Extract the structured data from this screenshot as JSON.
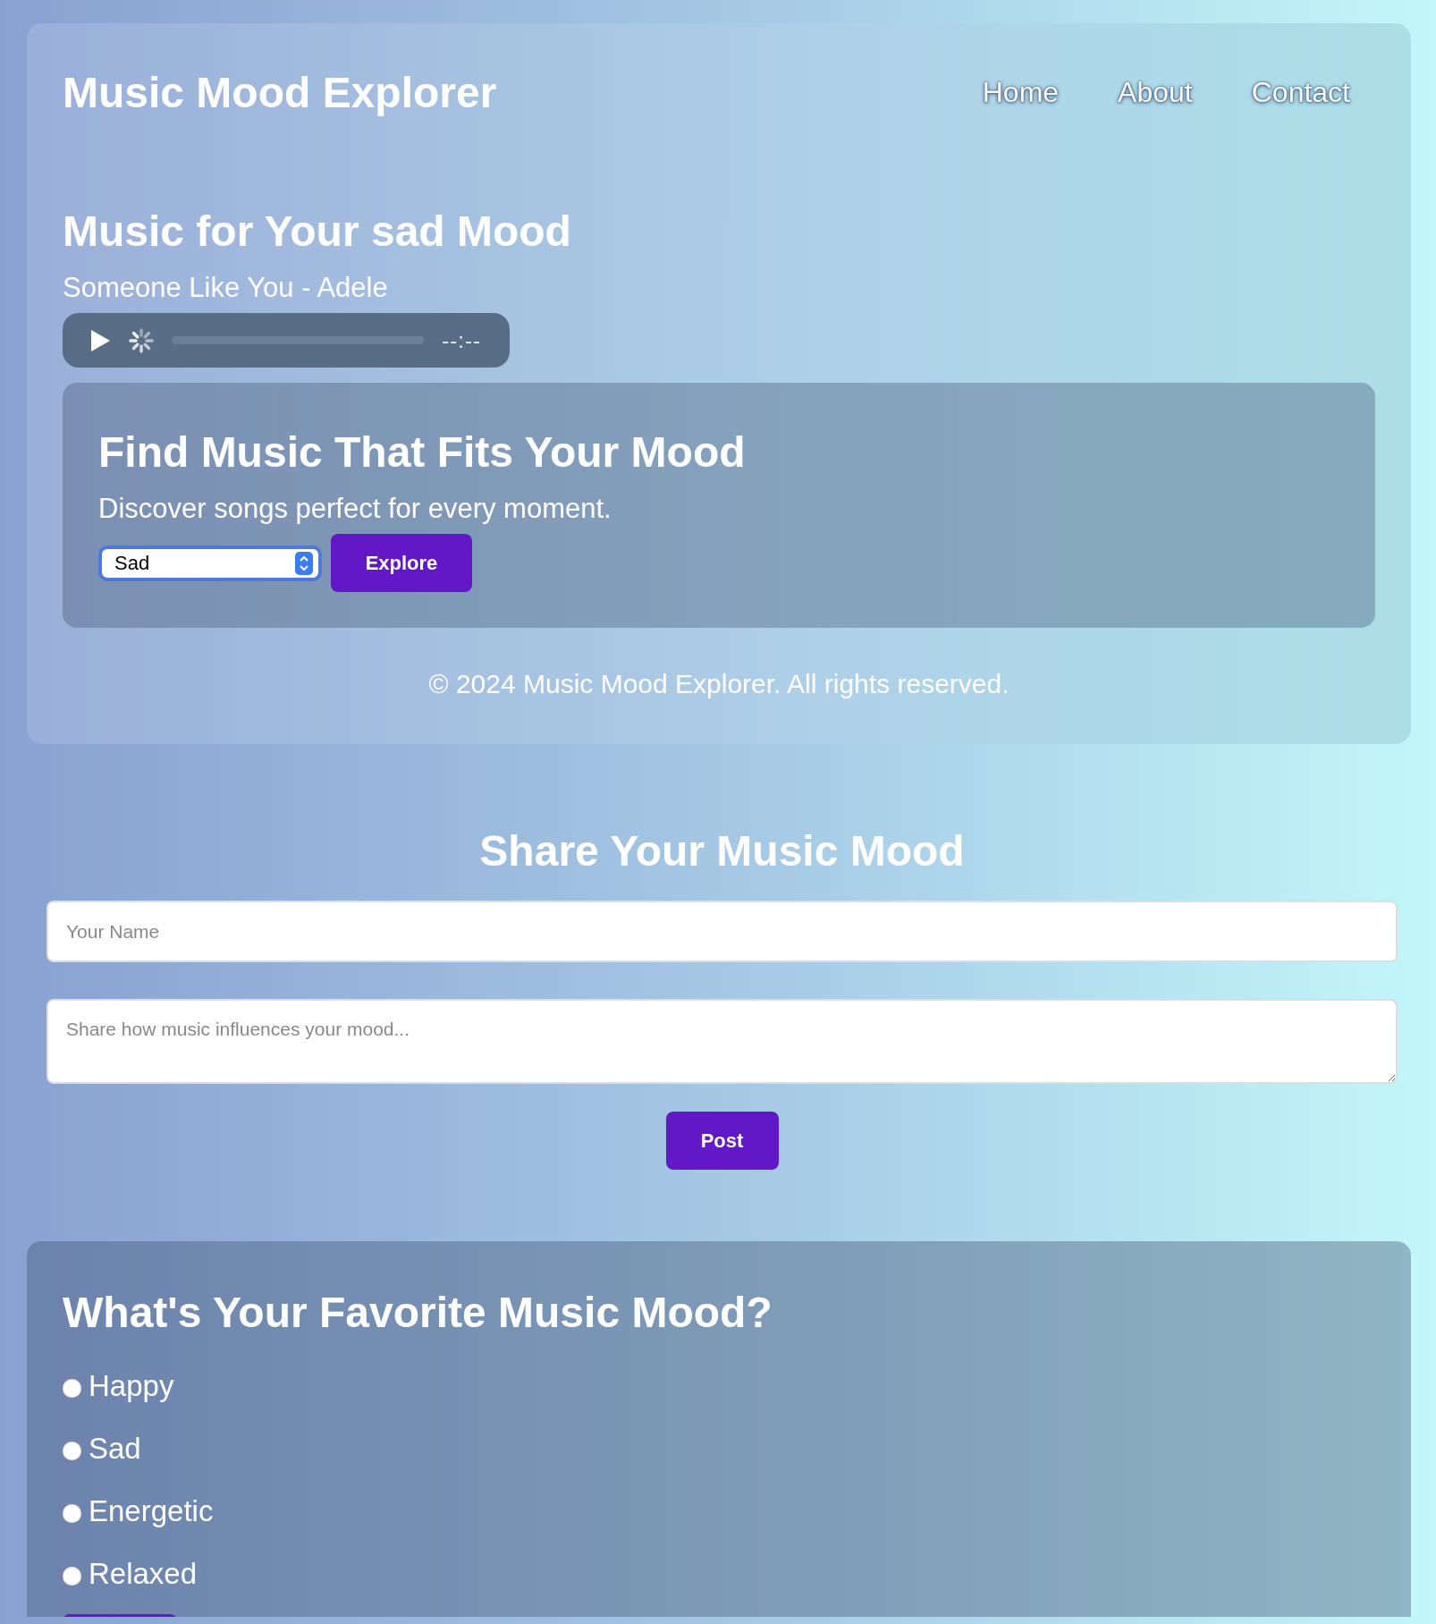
{
  "header": {
    "title": "Music Mood Explorer",
    "nav": [
      "Home",
      "About",
      "Contact"
    ]
  },
  "now_playing": {
    "heading": "Music for Your sad Mood",
    "track": "Someone Like You - Adele",
    "player": {
      "time": "--:--"
    }
  },
  "finder": {
    "heading": "Find Music That Fits Your Mood",
    "subtitle": "Discover songs perfect for every moment.",
    "mood_select": {
      "value": "Sad"
    },
    "button": "Explore"
  },
  "footer": "© 2024 Music Mood Explorer. All rights reserved.",
  "share": {
    "heading": "Share Your Music Mood",
    "name_field": {
      "placeholder": "Your Name"
    },
    "message_field": {
      "placeholder": "Share how music influences your mood..."
    },
    "button": "Post"
  },
  "poll": {
    "heading": "What's Your Favorite Music Mood?",
    "options": [
      {
        "label": "Happy",
        "selected": false
      },
      {
        "label": "Sad",
        "selected": false
      },
      {
        "label": "Energetic",
        "selected": false
      },
      {
        "label": "Relaxed",
        "selected": false
      }
    ]
  }
}
